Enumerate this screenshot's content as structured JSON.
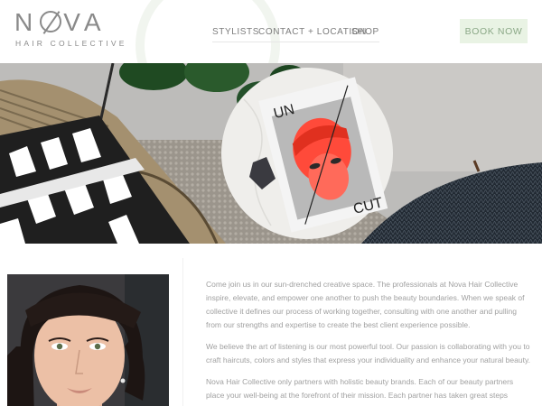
{
  "brand": {
    "name": "NOVA",
    "tagline": "HAIR COLLECTIVE"
  },
  "nav": {
    "items": [
      "STYLISTS",
      "CONTACT + LOCATION",
      "SHOP"
    ],
    "cta_label": "BOOK NOW"
  },
  "hero": {
    "magazine_top": "UN",
    "magazine_bottom": "CUT"
  },
  "about": {
    "paragraphs": [
      "Come join us in our sun-drenched creative space. The professionals at Nova Hair Collective inspire, elevate, and empower one another to push the beauty boundaries. When we speak of collective it defines our process of working together, consulting with one another and pulling from our strengths and expertise to create the best client experience possible.",
      "We believe the art of listening is our most powerful tool. Our passion is collaborating with you to craft haircuts, colors and styles that express your individuality and enhance your natural beauty.",
      "Nova Hair Collective only partners with holistic beauty brands. Each of our beauty partners place your well-being at the forefront of their mission. Each partner has taken great steps"
    ]
  },
  "colors": {
    "accent_green": "#e9f3e4",
    "accent_text": "#8ba887",
    "magazine_red": "#ff4a3a"
  }
}
